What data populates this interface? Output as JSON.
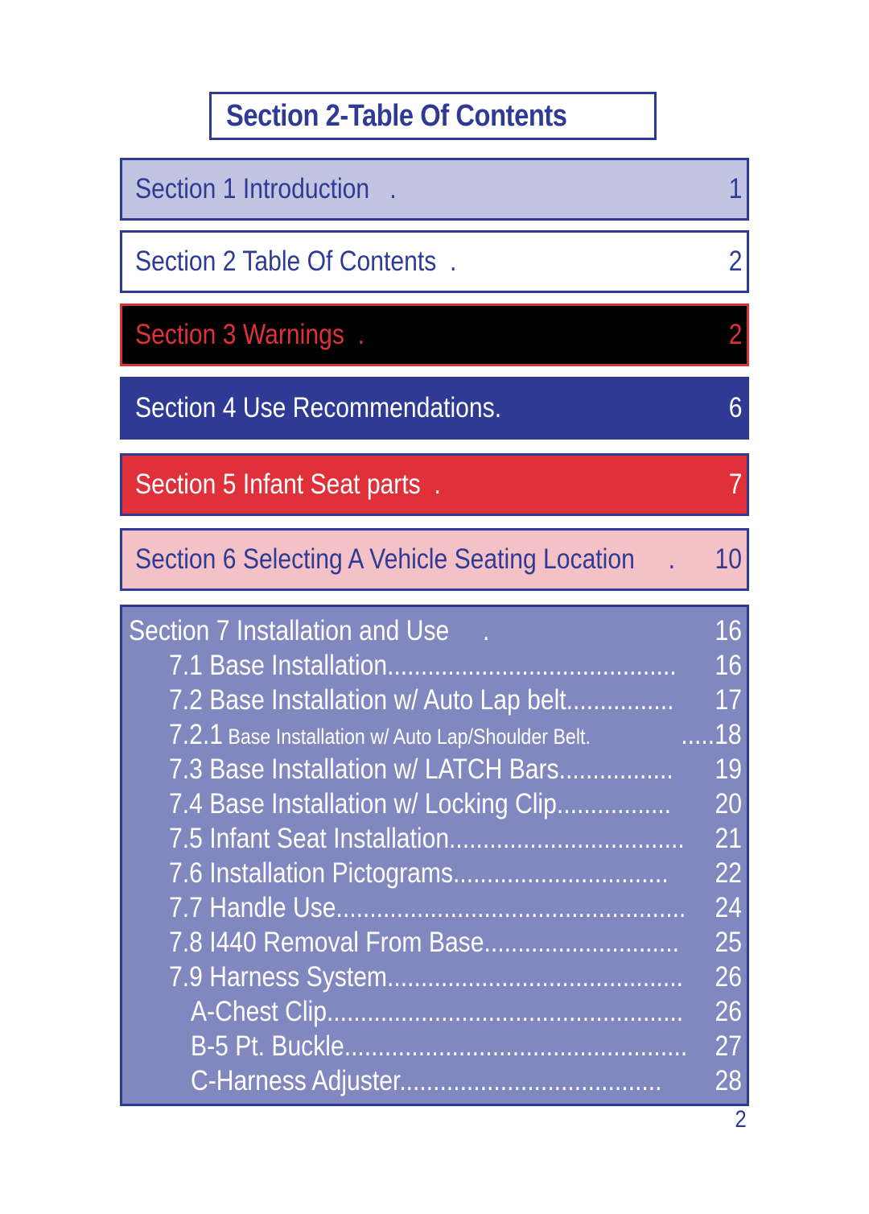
{
  "header": {
    "title": "Section 2-Table Of Contents"
  },
  "sections": [
    {
      "label": "Section 1 Introduction   .",
      "page": "1"
    },
    {
      "label": "Section 2 Table Of Contents  .",
      "page": "2"
    },
    {
      "label": "Section 3 Warnings  .",
      "page": "2"
    },
    {
      "label": "Section 4 Use Recommendations.",
      "page": "6"
    },
    {
      "label": "Section 5 Infant Seat parts  .",
      "page": "7"
    },
    {
      "label": "Section 6 Selecting A Vehicle Seating Location     .",
      "page": "10"
    }
  ],
  "section7": {
    "heading": {
      "label": "Section 7 Installation and Use     .",
      "page": "16"
    },
    "items": [
      {
        "label": "7.1 Base Installation...........................................",
        "page": "16"
      },
      {
        "label": "7.2 Base Installation w/ Auto Lap belt................",
        "page": "17"
      },
      {
        "num": "7.2.1",
        "label": " Base Installation w/ Auto Lap/Shoulder Belt.",
        "page": ".....18"
      },
      {
        "label": "7.3 Base Installation w/ LATCH Bars.................",
        "page": "19"
      },
      {
        "label": "7.4 Base Installation w/ Locking Clip.................",
        "page": "20"
      },
      {
        "label": "7.5 Infant Seat Installation...................................",
        "page": "21"
      },
      {
        "label": "7.6 Installation Pictograms................................",
        "page": "22"
      },
      {
        "label": "7.7 Handle Use....................................................",
        "page": "24"
      },
      {
        "label": "7.8 I440 Removal From Base.............................",
        "page": "25"
      },
      {
        "label": "7.9 Harness System............................................",
        "page": "26"
      },
      {
        "label": "A-Chest Clip.....................................................",
        "page": "26"
      },
      {
        "label": "B-5 Pt. Buckle...................................................",
        "page": "27"
      },
      {
        "label": "C-Harness Adjuster.......................................",
        "page": "28"
      }
    ]
  },
  "footer": {
    "page_number": "2"
  },
  "colors": {
    "navy": "#2e3a94",
    "red": "#e0303a",
    "lavender": "#c1c5e1",
    "pink": "#f4c2c6",
    "periwinkle": "#8088bf"
  }
}
